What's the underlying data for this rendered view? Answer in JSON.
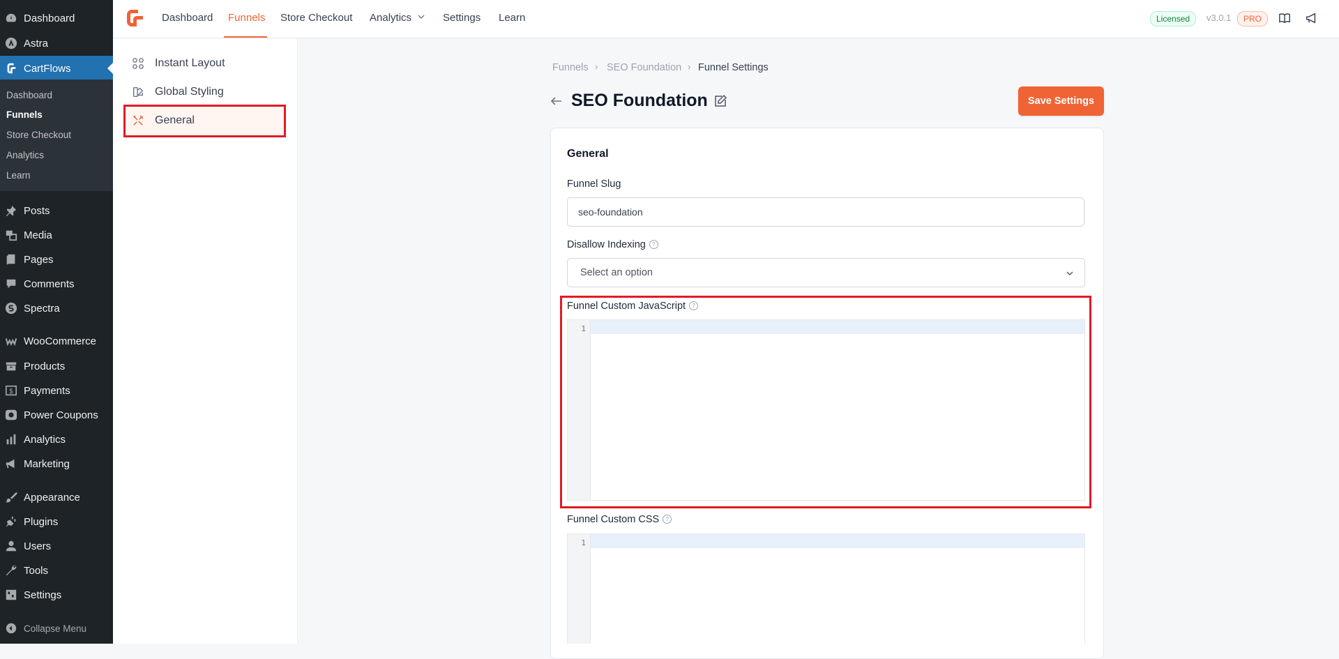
{
  "wp_sidebar": {
    "items": [
      {
        "label": "Dashboard",
        "icon": "dashboard-icon"
      },
      {
        "label": "Astra",
        "icon": "astra-icon"
      },
      {
        "label": "CartFlows",
        "icon": "cartflows-icon"
      },
      {
        "label": "Posts",
        "icon": "pin-icon"
      },
      {
        "label": "Media",
        "icon": "media-icon"
      },
      {
        "label": "Pages",
        "icon": "pages-icon"
      },
      {
        "label": "Comments",
        "icon": "comment-icon"
      },
      {
        "label": "Spectra",
        "icon": "spectra-icon"
      },
      {
        "label": "WooCommerce",
        "icon": "woocommerce-icon"
      },
      {
        "label": "Products",
        "icon": "archive-icon"
      },
      {
        "label": "Payments",
        "icon": "dollar-icon"
      },
      {
        "label": "Power Coupons",
        "icon": "coupon-icon"
      },
      {
        "label": "Analytics",
        "icon": "bar-chart-icon"
      },
      {
        "label": "Marketing",
        "icon": "megaphone-icon"
      },
      {
        "label": "Appearance",
        "icon": "brush-icon"
      },
      {
        "label": "Plugins",
        "icon": "plug-icon"
      },
      {
        "label": "Users",
        "icon": "user-icon"
      },
      {
        "label": "Tools",
        "icon": "wrench-icon"
      },
      {
        "label": "Settings",
        "icon": "settings-icon"
      }
    ],
    "submenu": [
      "Dashboard",
      "Funnels",
      "Store Checkout",
      "Analytics",
      "Learn"
    ],
    "collapse_label": "Collapse Menu"
  },
  "topbar": {
    "nav": [
      "Dashboard",
      "Funnels",
      "Store Checkout",
      "Analytics",
      "Settings",
      "Learn"
    ],
    "licensed": "Licensed",
    "version": "v3.0.1",
    "pro": "PRO"
  },
  "settings_menu": {
    "items": [
      {
        "label": "Instant Layout",
        "icon": "grid-icon"
      },
      {
        "label": "Global Styling",
        "icon": "palette-icon"
      },
      {
        "label": "General",
        "icon": "tools-icon"
      }
    ]
  },
  "breadcrumb": [
    "Funnels",
    "SEO Foundation",
    "Funnel Settings"
  ],
  "page_title": "SEO Foundation",
  "save_button": "Save Settings",
  "card": {
    "heading": "General",
    "slug_label": "Funnel Slug",
    "slug_value": "seo-foundation",
    "indexing_label": "Disallow Indexing",
    "indexing_placeholder": "Select an option",
    "js_label": "Funnel Custom JavaScript",
    "css_label": "Funnel Custom CSS",
    "line_number": "1"
  },
  "colors": {
    "accent": "#f06335",
    "wp_active": "#2271b1",
    "highlight": "#e01b24"
  }
}
